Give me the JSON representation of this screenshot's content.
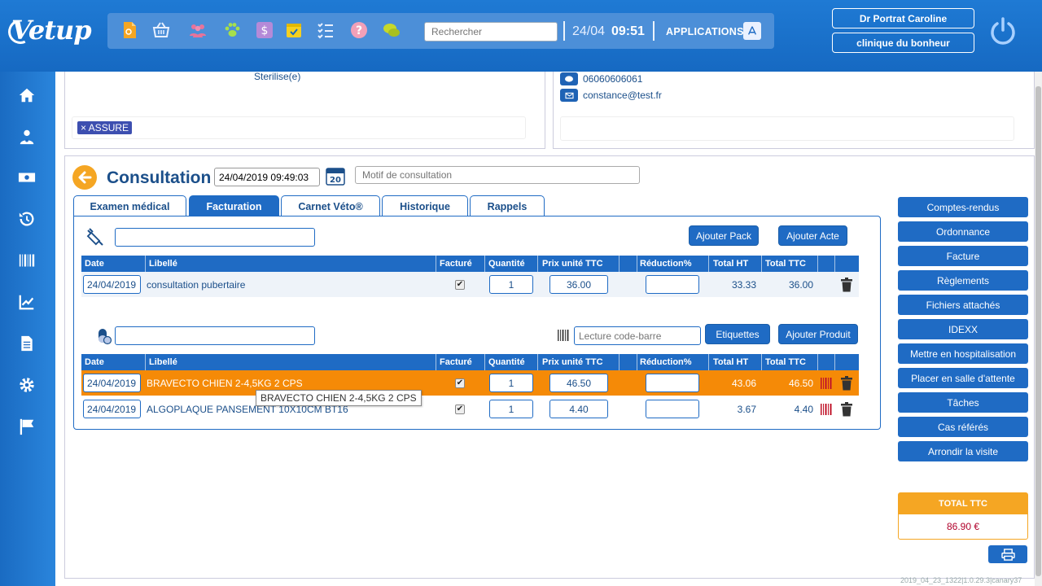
{
  "app": {
    "logo": "Vetup"
  },
  "toolbar": {
    "icons": [
      "document-icon",
      "basket-icon",
      "users-icon",
      "paw-icon",
      "dollar-icon",
      "calendar-icon",
      "checklist-icon",
      "help-icon",
      "chat-icon"
    ],
    "search_placeholder": "Rechercher",
    "date": "24/04",
    "time": "09:51",
    "apps_label": "APPLICATIONS"
  },
  "user": {
    "name": "Dr Portrat Caroline",
    "clinic": "clinique du bonheur"
  },
  "sidebar": {
    "items": [
      "home-icon",
      "vet-icon",
      "money-icon",
      "history-icon",
      "barcode-icon",
      "stats-icon",
      "document-icon",
      "settings-icon",
      "flag-icon"
    ]
  },
  "animal": {
    "status": "Sterilise(e)",
    "tag": "× ASSURE"
  },
  "owner": {
    "phone": "06060606061",
    "email": "constance@test.fr"
  },
  "consultation": {
    "title": "Consultation",
    "datetime": "24/04/2019 09:49:03",
    "motif_placeholder": "Motif de consultation",
    "tabs": [
      "Examen médical",
      "Facturation",
      "Carnet Véto®",
      "Historique",
      "Rappels"
    ],
    "active_tab": "Facturation"
  },
  "acts": {
    "add_pack": "Ajouter Pack",
    "add_act": "Ajouter Acte",
    "columns": [
      "Date",
      "Libellé",
      "Facturé",
      "Quantité",
      "Prix unité TTC",
      "Réduction%",
      "Total HT",
      "Total TTC"
    ],
    "rows": [
      {
        "date": "24/04/2019",
        "label": "consultation pubertaire",
        "billed": "✔",
        "qty": "1",
        "unit_price": "36.00",
        "reduction": "",
        "total_ht": "33.33",
        "total_ttc": "36.00"
      }
    ]
  },
  "products": {
    "barcode_placeholder": "Lecture code-barre",
    "labels_btn": "Etiquettes",
    "add_product": "Ajouter Produit",
    "columns": [
      "Date",
      "Libellé",
      "Facturé",
      "Quantité",
      "Prix unité TTC",
      "Réduction%",
      "Total HT",
      "Total TTC"
    ],
    "rows": [
      {
        "date": "24/04/2019",
        "label": "BRAVECTO CHIEN 2-4,5KG 2 CPS",
        "billed": "✔",
        "qty": "1",
        "unit_price": "46.50",
        "reduction": "",
        "total_ht": "43.06",
        "total_ttc": "46.50"
      },
      {
        "date": "24/04/2019",
        "label": "ALGOPLAQUE PANSEMENT 10X10CM BT16",
        "billed": "✔",
        "qty": "1",
        "unit_price": "4.40",
        "reduction": "",
        "total_ht": "3.67",
        "total_ttc": "4.40"
      }
    ],
    "tooltip": "BRAVECTO CHIEN 2-4,5KG 2 CPS"
  },
  "actions": [
    "Comptes-rendus",
    "Ordonnance",
    "Facture",
    "Règlements",
    "Fichiers attachés",
    "IDEXX",
    "Mettre en hospitalisation",
    "Placer en salle d'attente",
    "Tâches",
    "Cas référés",
    "Arrondir la visite"
  ],
  "total": {
    "label": "TOTAL TTC",
    "value": "86.90 €"
  },
  "version": "2019_04_23_1322|1.0.29.3|canary37",
  "colors": {
    "primary": "#1f6bc4",
    "orange": "#f58a07",
    "accent": "#f5a623",
    "price_red": "#b0002a"
  }
}
